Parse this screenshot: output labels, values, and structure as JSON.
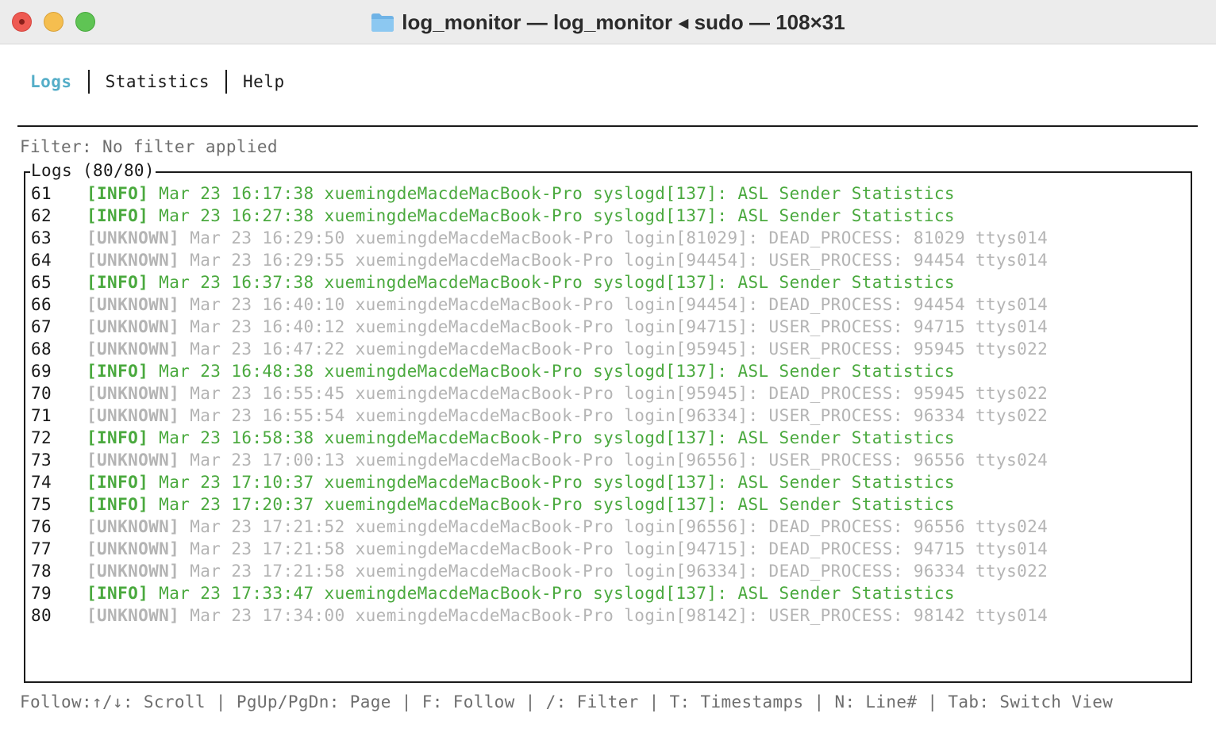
{
  "window": {
    "title": "log_monitor — log_monitor ◂ sudo — 108×31"
  },
  "tabs": [
    {
      "label": "Logs",
      "active": true
    },
    {
      "label": "Statistics",
      "active": false
    },
    {
      "label": "Help",
      "active": false
    }
  ],
  "filter": {
    "text": "Filter: No filter applied"
  },
  "logs": {
    "title": "Logs (80/80)",
    "rows": [
      {
        "num": "61",
        "level": "[INFO]",
        "type": "info",
        "message": "Mar 23 16:17:38 xuemingdeMacdeMacBook-Pro syslogd[137]: ASL Sender Statistics"
      },
      {
        "num": "62",
        "level": "[INFO]",
        "type": "info",
        "message": "Mar 23 16:27:38 xuemingdeMacdeMacBook-Pro syslogd[137]: ASL Sender Statistics"
      },
      {
        "num": "63",
        "level": "[UNKNOWN]",
        "type": "unknown",
        "message": "Mar 23 16:29:50 xuemingdeMacdeMacBook-Pro login[81029]: DEAD_PROCESS: 81029 ttys014"
      },
      {
        "num": "64",
        "level": "[UNKNOWN]",
        "type": "unknown",
        "message": "Mar 23 16:29:55 xuemingdeMacdeMacBook-Pro login[94454]: USER_PROCESS: 94454 ttys014"
      },
      {
        "num": "65",
        "level": "[INFO]",
        "type": "info",
        "message": "Mar 23 16:37:38 xuemingdeMacdeMacBook-Pro syslogd[137]: ASL Sender Statistics"
      },
      {
        "num": "66",
        "level": "[UNKNOWN]",
        "type": "unknown",
        "message": "Mar 23 16:40:10 xuemingdeMacdeMacBook-Pro login[94454]: DEAD_PROCESS: 94454 ttys014"
      },
      {
        "num": "67",
        "level": "[UNKNOWN]",
        "type": "unknown",
        "message": "Mar 23 16:40:12 xuemingdeMacdeMacBook-Pro login[94715]: USER_PROCESS: 94715 ttys014"
      },
      {
        "num": "68",
        "level": "[UNKNOWN]",
        "type": "unknown",
        "message": "Mar 23 16:47:22 xuemingdeMacdeMacBook-Pro login[95945]: USER_PROCESS: 95945 ttys022"
      },
      {
        "num": "69",
        "level": "[INFO]",
        "type": "info",
        "message": "Mar 23 16:48:38 xuemingdeMacdeMacBook-Pro syslogd[137]: ASL Sender Statistics"
      },
      {
        "num": "70",
        "level": "[UNKNOWN]",
        "type": "unknown",
        "message": "Mar 23 16:55:45 xuemingdeMacdeMacBook-Pro login[95945]: DEAD_PROCESS: 95945 ttys022"
      },
      {
        "num": "71",
        "level": "[UNKNOWN]",
        "type": "unknown",
        "message": "Mar 23 16:55:54 xuemingdeMacdeMacBook-Pro login[96334]: USER_PROCESS: 96334 ttys022"
      },
      {
        "num": "72",
        "level": "[INFO]",
        "type": "info",
        "message": "Mar 23 16:58:38 xuemingdeMacdeMacBook-Pro syslogd[137]: ASL Sender Statistics"
      },
      {
        "num": "73",
        "level": "[UNKNOWN]",
        "type": "unknown",
        "message": "Mar 23 17:00:13 xuemingdeMacdeMacBook-Pro login[96556]: USER_PROCESS: 96556 ttys024"
      },
      {
        "num": "74",
        "level": "[INFO]",
        "type": "info",
        "message": "Mar 23 17:10:37 xuemingdeMacdeMacBook-Pro syslogd[137]: ASL Sender Statistics"
      },
      {
        "num": "75",
        "level": "[INFO]",
        "type": "info",
        "message": "Mar 23 17:20:37 xuemingdeMacdeMacBook-Pro syslogd[137]: ASL Sender Statistics"
      },
      {
        "num": "76",
        "level": "[UNKNOWN]",
        "type": "unknown",
        "message": "Mar 23 17:21:52 xuemingdeMacdeMacBook-Pro login[96556]: DEAD_PROCESS: 96556 ttys024"
      },
      {
        "num": "77",
        "level": "[UNKNOWN]",
        "type": "unknown",
        "message": "Mar 23 17:21:58 xuemingdeMacdeMacBook-Pro login[94715]: DEAD_PROCESS: 94715 ttys014"
      },
      {
        "num": "78",
        "level": "[UNKNOWN]",
        "type": "unknown",
        "message": "Mar 23 17:21:58 xuemingdeMacdeMacBook-Pro login[96334]: DEAD_PROCESS: 96334 ttys022"
      },
      {
        "num": "79",
        "level": "[INFO]",
        "type": "info",
        "message": "Mar 23 17:33:47 xuemingdeMacdeMacBook-Pro syslogd[137]: ASL Sender Statistics"
      },
      {
        "num": "80",
        "level": "[UNKNOWN]",
        "type": "unknown",
        "message": "Mar 23 17:34:00 xuemingdeMacdeMacBook-Pro login[98142]: USER_PROCESS: 98142 ttys014"
      }
    ]
  },
  "footer": {
    "text": "Follow:↑/↓: Scroll | PgUp/PgDn: Page | F: Follow | /: Filter | T: Timestamps | N: Line# | Tab: Switch View"
  },
  "colors": {
    "active_tab": "#55aec8",
    "info": "#4aa93e",
    "unknown": "#b4b4b4",
    "muted": "#6e6e6e"
  },
  "icons": {
    "title_folder": "folder-icon"
  }
}
